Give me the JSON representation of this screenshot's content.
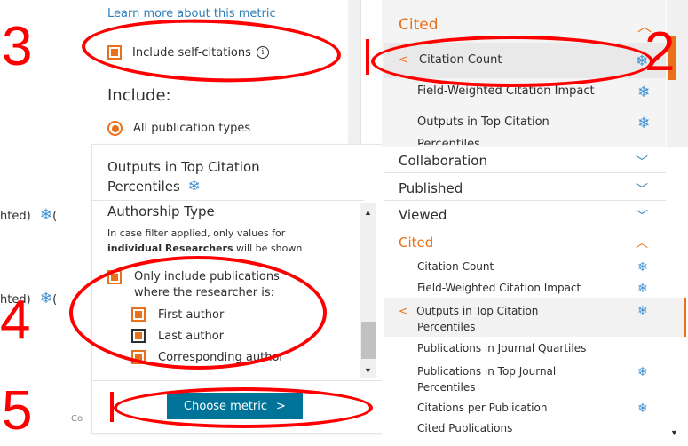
{
  "left": {
    "row1": "hted)",
    "row2": "hted)",
    "partial": "Co"
  },
  "top_panel": {
    "learn_more": "Learn more about this metric",
    "self_citations_label": "Include self-citations",
    "info_glyph": "i",
    "include_heading": "Include:",
    "all_types_label": "All publication types"
  },
  "bottom_panel": {
    "heading_line1": "Outputs in Top Citation",
    "heading_line2": "Percentiles",
    "authorship_heading": "Authorship Type",
    "note_line1": "In case filter applied, only values for",
    "note_line2_bold": "individual Researchers",
    "note_line2_rest": " will be shown",
    "only_include_line1": "Only include publications",
    "only_include_line2": "where the researcher is:",
    "first_author": "First author",
    "last_author": "Last author",
    "corresponding_author": "Corresponding author",
    "choose_metric": "Choose metric",
    "choose_metric_arrow": ">"
  },
  "right_panel": {
    "top": {
      "cited_title": "Cited",
      "citation_count": "Citation Count",
      "fwci": "Field-Weighted Citation Impact",
      "outputs_top": "Outputs in Top Citation",
      "outputs_top_cut": "Percentiles"
    },
    "sections": [
      "Collaboration",
      "Published",
      "Viewed"
    ],
    "cited_title": "Cited",
    "cited_items": {
      "citation_count": "Citation Count",
      "fwci": "Field-Weighted Citation Impact",
      "outputs_top_line1": "Outputs in Top Citation",
      "outputs_top_line2": "Percentiles",
      "journal_quartiles": "Publications in Journal Quartiles",
      "top_journal_line1": "Publications in Top Journal",
      "top_journal_line2": "Percentiles",
      "citations_per_pub": "Citations per Publication",
      "cited_pubs": "Cited Publications"
    }
  },
  "annotations": [
    "3",
    "2",
    "4",
    "5"
  ],
  "colors": {
    "accent": "#e9711c",
    "link": "#2e7fb8",
    "button": "#007398",
    "annotation": "#ff0000"
  }
}
